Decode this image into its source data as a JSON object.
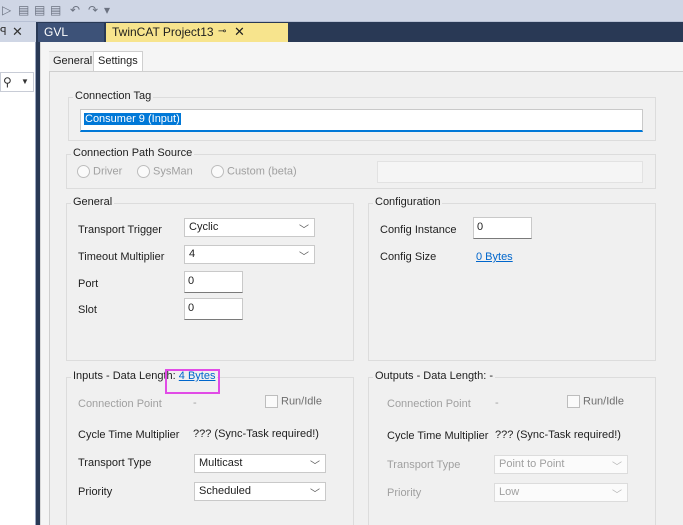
{
  "left_panel": {
    "pin_icon": "pin-icon",
    "close_icon": "close-icon",
    "search_icon": "search-icon"
  },
  "doc_tabs": [
    {
      "label": "GVL"
    },
    {
      "label": "TwinCAT Project13"
    }
  ],
  "inner_tabs": {
    "general": "General",
    "settings": "Settings"
  },
  "connection_tag": {
    "legend": "Connection Tag",
    "value": "Consumer 9 (Input)"
  },
  "connection_path": {
    "legend": "Connection Path Source",
    "options": [
      "Driver",
      "SysMan",
      "Custom (beta)"
    ]
  },
  "general": {
    "legend": "General",
    "transport_trigger_label": "Transport Trigger",
    "transport_trigger_value": "Cyclic",
    "timeout_multiplier_label": "Timeout Multiplier",
    "timeout_multiplier_value": "4",
    "port_label": "Port",
    "port_value": "0",
    "slot_label": "Slot",
    "slot_value": "0"
  },
  "configuration": {
    "legend": "Configuration",
    "instance_label": "Config Instance",
    "instance_value": "0",
    "size_label": "Config Size",
    "size_value": "0 Bytes"
  },
  "inputs": {
    "legend": "Inputs - Data Length:",
    "length_link": "4 Bytes",
    "connection_point_label": "Connection Point",
    "connection_point_value": "-",
    "run_idle_label": "Run/Idle",
    "cycle_time_label": "Cycle Time Multiplier",
    "cycle_time_value": "??? (Sync-Task required!)",
    "transport_type_label": "Transport Type",
    "transport_type_value": "Multicast",
    "priority_label": "Priority",
    "priority_value": "Scheduled"
  },
  "outputs": {
    "legend": "Outputs - Data Length: -",
    "connection_point_label": "Connection Point",
    "connection_point_value": "-",
    "run_idle_label": "Run/Idle",
    "cycle_time_label": "Cycle Time Multiplier",
    "cycle_time_value": "??? (Sync-Task required!)",
    "transport_type_label": "Transport Type",
    "transport_type_value": "Point to Point",
    "priority_label": "Priority",
    "priority_value": "Low"
  },
  "colors": {
    "accent": "#0078d7",
    "active_tab": "#f7e48d",
    "highlight": "#e14be6",
    "link": "#0066cc"
  }
}
